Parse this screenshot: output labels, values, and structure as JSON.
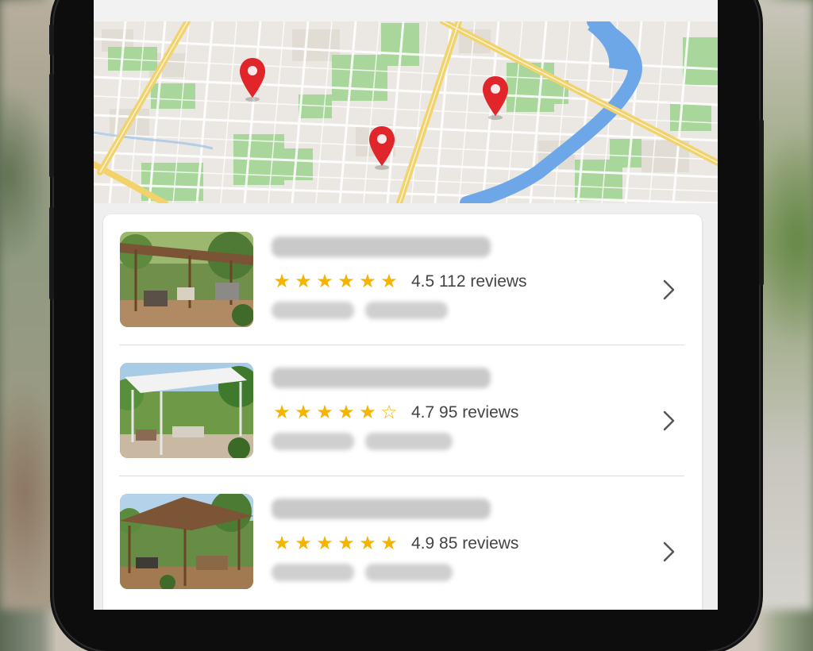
{
  "listings": [
    {
      "rating": "4.5",
      "reviews": "112 reviews",
      "stars": [
        "★",
        "★",
        "★",
        "★",
        "★",
        "★"
      ],
      "photo": "pergola-patio-photo-1"
    },
    {
      "rating": "4.7",
      "reviews": "95 reviews",
      "stars": [
        "★",
        "★",
        "★",
        "★",
        "★",
        "☆"
      ],
      "photo": "pergola-patio-photo-2"
    },
    {
      "rating": "4.9",
      "reviews": "85 reviews",
      "stars": [
        "★",
        "★",
        "★",
        "★",
        "★",
        "★"
      ],
      "photo": "pergola-patio-photo-3"
    }
  ],
  "map": {
    "pins": [
      "location-pin-icon",
      "location-pin-icon",
      "location-pin-icon"
    ]
  },
  "colors": {
    "pin": "#e0262b",
    "star": "#f4b400",
    "river": "#6aa4e6",
    "road": "#f2d36a",
    "park": "#a7d59a"
  }
}
